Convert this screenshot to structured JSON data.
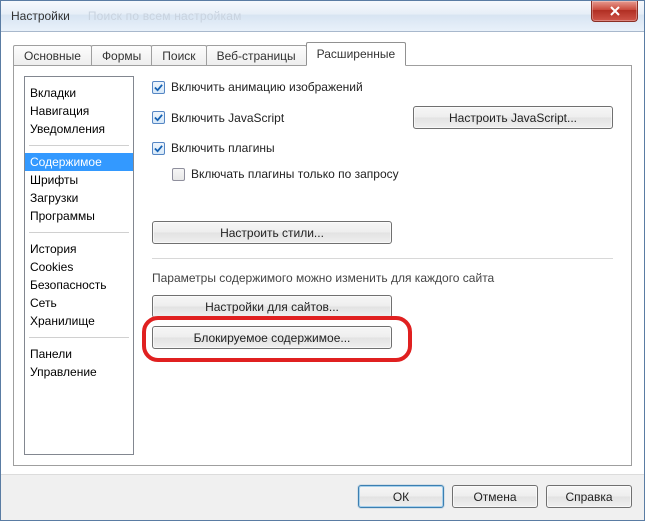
{
  "window": {
    "title": "Настройки",
    "ghost_text": "Поиск по всем настройкам",
    "close": "✕"
  },
  "tabs": [
    {
      "label": "Основные"
    },
    {
      "label": "Формы"
    },
    {
      "label": "Поиск"
    },
    {
      "label": "Веб-страницы"
    },
    {
      "label": "Расширенные"
    }
  ],
  "sidebar": {
    "g1": [
      {
        "label": "Вкладки"
      },
      {
        "label": "Навигация"
      },
      {
        "label": "Уведомления"
      }
    ],
    "g2": [
      {
        "label": "Содержимое",
        "selected": true
      },
      {
        "label": "Шрифты"
      },
      {
        "label": "Загрузки"
      },
      {
        "label": "Программы"
      }
    ],
    "g3": [
      {
        "label": "История"
      },
      {
        "label": "Cookies"
      },
      {
        "label": "Безопасность"
      },
      {
        "label": "Сеть"
      },
      {
        "label": "Хранилище"
      }
    ],
    "g4": [
      {
        "label": "Панели"
      },
      {
        "label": "Управление"
      }
    ]
  },
  "content": {
    "chk_anim": "Включить анимацию изображений",
    "chk_js": "Включить JavaScript",
    "btn_js": "Настроить JavaScript...",
    "chk_plugins": "Включить плагины",
    "chk_plugins_ondemand": "Включать плагины только по запросу",
    "btn_styles": "Настроить стили...",
    "desc": "Параметры содержимого можно изменить для каждого сайта",
    "btn_sites": "Настройки для сайтов...",
    "btn_blocked": "Блокируемое содержимое..."
  },
  "buttons": {
    "ok": "ОК",
    "cancel": "Отмена",
    "help": "Справка"
  }
}
